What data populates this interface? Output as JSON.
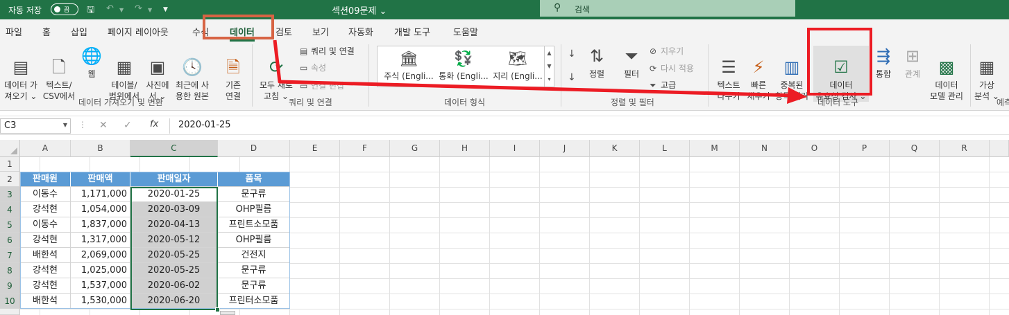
{
  "titlebar": {
    "autosave_label": "자동 저장",
    "autosave_state": "끔",
    "filename": "섹션09문제 ⌄",
    "search_placeholder": "검색"
  },
  "menu": {
    "tabs": [
      "파일",
      "홈",
      "삽입",
      "페이지 레이아웃",
      "수식",
      "데이터",
      "검토",
      "보기",
      "자동화",
      "개발 도구",
      "도움말"
    ],
    "active_tab": "데이터"
  },
  "ribbon": {
    "get_data": "데이터 가\n져오기 ⌄",
    "from_text": "텍스트/\nCSV에서",
    "from_web": "웹",
    "from_table": "테이블/\n범위에서",
    "from_picture": "사진에\n서 ⌄",
    "recent_sources": "최근에 사\n용한 원본",
    "existing_conn": "기존\n연결",
    "group_get_data": "데이터 가져오기 및 변환",
    "refresh_all": "모두 새로\n고침 ⌄",
    "queries_conn": "쿼리 및 연결",
    "properties": "속성",
    "edit_links": "연결 편집",
    "group_queries": "쿼리 및 연결",
    "dt_stocks": "주식 (Engli...",
    "dt_currency": "통화 (Engli...",
    "dt_geo": "지리 (Engli...",
    "group_datatypes": "데이터 형식",
    "sort": "정렬",
    "filter": "필터",
    "clear": "지우기",
    "reapply": "다시 적용",
    "advanced": "고급",
    "group_sort": "정렬 및 필터",
    "text_to_columns": "텍스트\n나누기",
    "flash_fill": "빠른\n채우기",
    "remove_dup": "중복된\n항목 제거",
    "data_validation": "데이터\n유효성 검사 ⌄",
    "consolidate": "통합",
    "relationships": "관계",
    "data_model": "데이터\n모델 관리",
    "group_datatools": "데이터 도구",
    "whatif": "가상\n분석 ⌄",
    "group_forecast": "예측"
  },
  "formula_bar": {
    "name_box": "C3",
    "formula": "2020-01-25"
  },
  "grid": {
    "columns": [
      "A",
      "B",
      "C",
      "D",
      "E",
      "F",
      "G",
      "H",
      "I",
      "J",
      "K",
      "L",
      "M",
      "N",
      "O",
      "P",
      "Q",
      "R"
    ],
    "rows": [
      "1",
      "2",
      "3",
      "4",
      "5",
      "6",
      "7",
      "8",
      "9",
      "10"
    ],
    "headers": [
      "판매원",
      "판매액",
      "판매일자",
      "품목"
    ],
    "data": [
      [
        "이동수",
        "1,171,000",
        "2020-01-25",
        "문구류"
      ],
      [
        "강석현",
        "1,054,000",
        "2020-03-09",
        "OHP필름"
      ],
      [
        "이동수",
        "1,837,000",
        "2020-04-13",
        "프린트소모품"
      ],
      [
        "강석현",
        "1,317,000",
        "2020-05-12",
        "OHP필름"
      ],
      [
        "배한석",
        "2,069,000",
        "2020-05-25",
        "건전지"
      ],
      [
        "강석현",
        "1,025,000",
        "2020-05-25",
        "문구류"
      ],
      [
        "강석현",
        "1,537,000",
        "2020-06-02",
        "문구류"
      ],
      [
        "배한석",
        "1,530,000",
        "2020-06-20",
        "프린터소모품"
      ]
    ]
  },
  "colors": {
    "excel_green": "#217346",
    "table_header": "#5b9bd5",
    "tab_highlight": "#d76444",
    "annotation_red": "#ec1c24"
  }
}
